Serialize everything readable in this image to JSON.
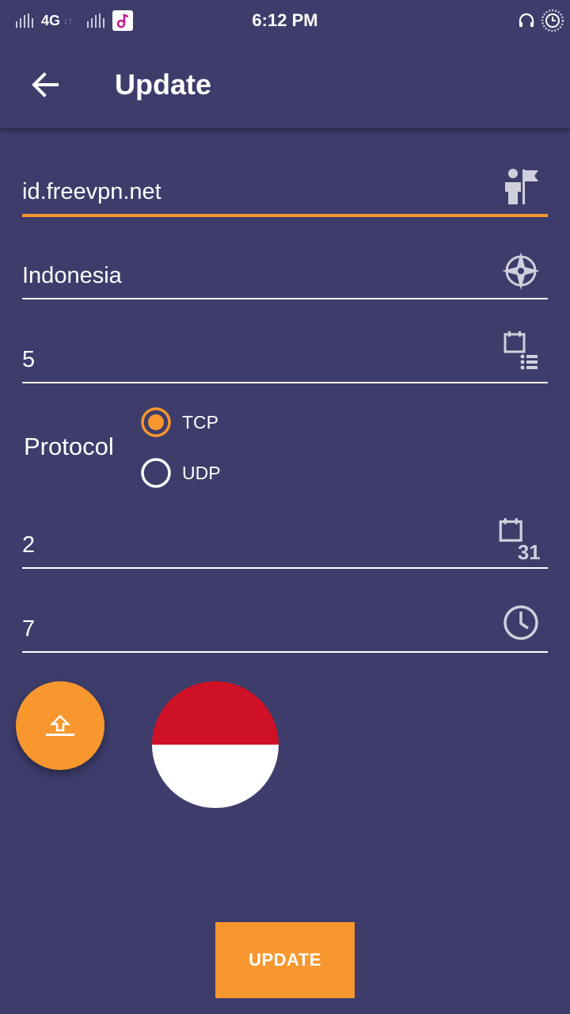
{
  "status_bar": {
    "network": "4G",
    "time": "6:12 PM"
  },
  "app_bar": {
    "title": "Update"
  },
  "form": {
    "server": {
      "value": "id.freevpn.net",
      "icon": "guide-flag-icon"
    },
    "country": {
      "value": "Indonesia",
      "icon": "compass-icon"
    },
    "slot": {
      "value": "5",
      "icon": "calendar-list-icon"
    },
    "protocol": {
      "label": "Protocol",
      "options": [
        {
          "label": "TCP",
          "selected": true
        },
        {
          "label": "UDP",
          "selected": false
        }
      ]
    },
    "days": {
      "value": "2",
      "icon": "calendar-31-icon",
      "icon_text": "31"
    },
    "hours": {
      "value": "7",
      "icon": "clock-icon"
    }
  },
  "flag": {
    "country": "Indonesia",
    "colors": [
      "#ce1126",
      "#ffffff"
    ]
  },
  "actions": {
    "upload_icon": "upload-icon",
    "update_label": "UPDATE"
  },
  "colors": {
    "background": "#3d3c6b",
    "accent": "#f7972e"
  }
}
